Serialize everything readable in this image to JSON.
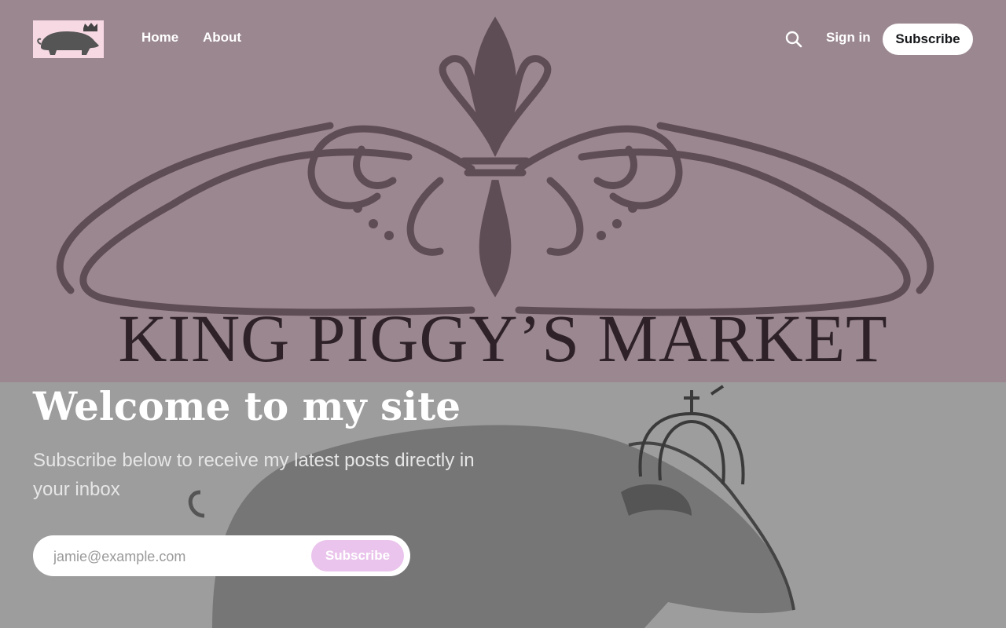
{
  "nav": {
    "logo_alt": "King Piggy's Market logo",
    "links": [
      "Home",
      "About"
    ],
    "signin_label": "Sign in",
    "subscribe_label": "Subscribe",
    "search_icon": "search-icon"
  },
  "banner": {
    "wordmark": "KING PIGGY’S MARKET"
  },
  "hero": {
    "title": "Welcome to my site",
    "subtitle": "Subscribe below to receive my latest posts directly in your inbox",
    "email_placeholder": "jamie@example.com",
    "form_button_label": "Subscribe"
  },
  "colors": {
    "banner_bg": "#9b8790",
    "accent": "#eac4ec",
    "text_light": "#ffffff"
  }
}
